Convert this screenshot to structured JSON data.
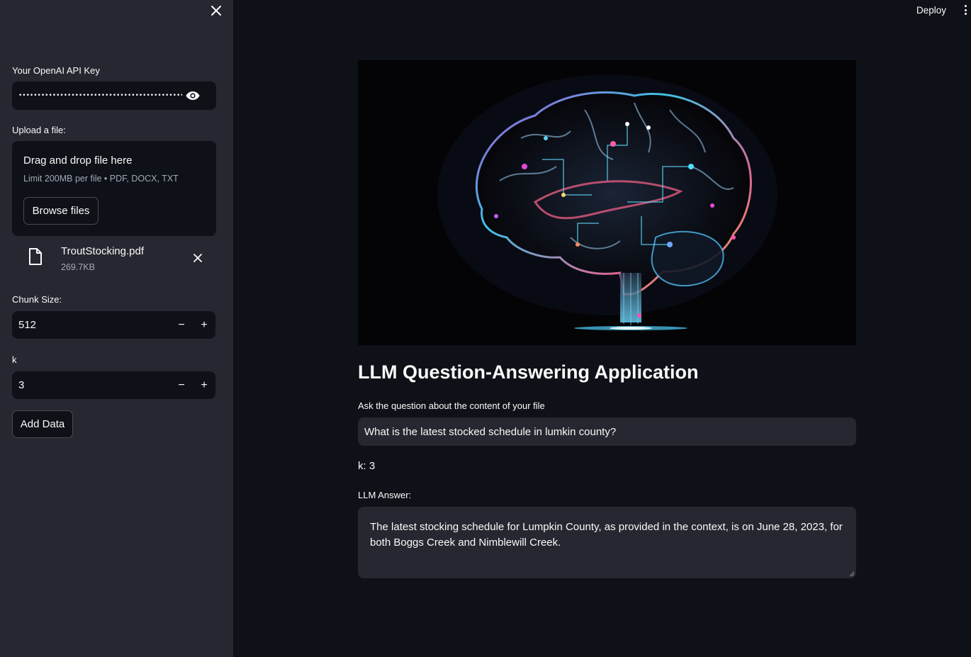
{
  "sidebar": {
    "api_key_label": "Your OpenAI API Key",
    "api_key_value": "••••••••••••••••••••••••••••••••••••••••••••••••••",
    "upload_label": "Upload a file:",
    "dropzone_title": "Drag and drop file here",
    "dropzone_limit": "Limit 200MB per file • PDF, DOCX, TXT",
    "browse_label": "Browse files",
    "uploaded_file": {
      "name": "TroutStocking.pdf",
      "size": "269.7KB"
    },
    "chunk_size_label": "Chunk Size:",
    "chunk_size_value": "512",
    "k_label": "k",
    "k_value": "3",
    "decrement_symbol": "−",
    "increment_symbol": "+",
    "add_data_label": "Add Data"
  },
  "header": {
    "deploy_label": "Deploy"
  },
  "main": {
    "hero_image_icon": "glowing-circuit-brain-image",
    "title": "LLM Question-Answering Application",
    "question_label": "Ask the question about the content of your file",
    "question_value": "What is the latest stocked schedule in lumkin county?",
    "k_readout": "k: 3",
    "answer_label": "LLM Answer:",
    "answer_value": "The latest stocking schedule for Lumpkin County, as provided in the context, is on June 28, 2023, for both Boggs Creek and Nimblewill Creek."
  },
  "colors": {
    "sidebar_bg": "#262730",
    "main_bg": "#0e1117",
    "input_bg": "#0e1117",
    "text": "#fafafa",
    "muted_text": "#a3a8b8"
  }
}
